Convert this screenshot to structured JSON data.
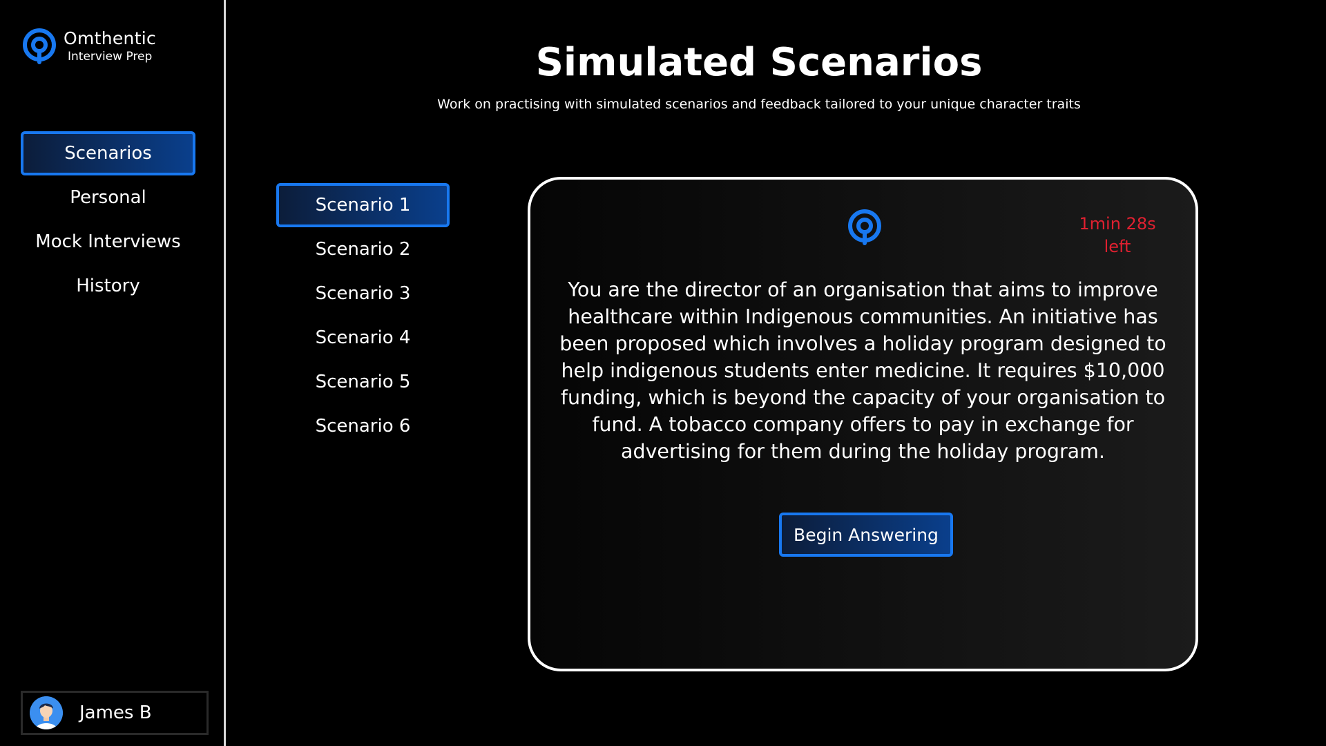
{
  "brand": {
    "name": "Omthentic",
    "subtitle": "Interview Prep"
  },
  "sidebar": {
    "items": [
      {
        "label": "Scenarios",
        "active": true
      },
      {
        "label": "Personal",
        "active": false
      },
      {
        "label": "Mock Interviews",
        "active": false
      },
      {
        "label": "History",
        "active": false
      }
    ]
  },
  "user": {
    "name": "James B"
  },
  "page": {
    "title": "Simulated Scenarios",
    "subtitle": "Work on practising with simulated scenarios and feedback tailored to your unique character traits"
  },
  "scenarios": {
    "items": [
      {
        "label": "Scenario 1",
        "active": true
      },
      {
        "label": "Scenario 2",
        "active": false
      },
      {
        "label": "Scenario 3",
        "active": false
      },
      {
        "label": "Scenario 4",
        "active": false
      },
      {
        "label": "Scenario 5",
        "active": false
      },
      {
        "label": "Scenario 6",
        "active": false
      }
    ]
  },
  "card": {
    "timer_line1": "1min 28s",
    "timer_line2": "left",
    "text": "You are the director of an organisation that aims to improve healthcare within Indigenous communities. An initiative has been proposed which involves a holiday program designed to help indigenous students enter medicine. It requires $10,000 funding, which is beyond the capacity of your organisation to fund. A tobacco company offers to pay in exchange for advertising for them during the holiday program.",
    "button_label": "Begin Answering"
  },
  "colors": {
    "accent": "#1878f0",
    "timer": "#e02030",
    "background": "#000000"
  },
  "icons": {
    "logo": "brand-logo-icon",
    "avatar": "user-avatar"
  }
}
